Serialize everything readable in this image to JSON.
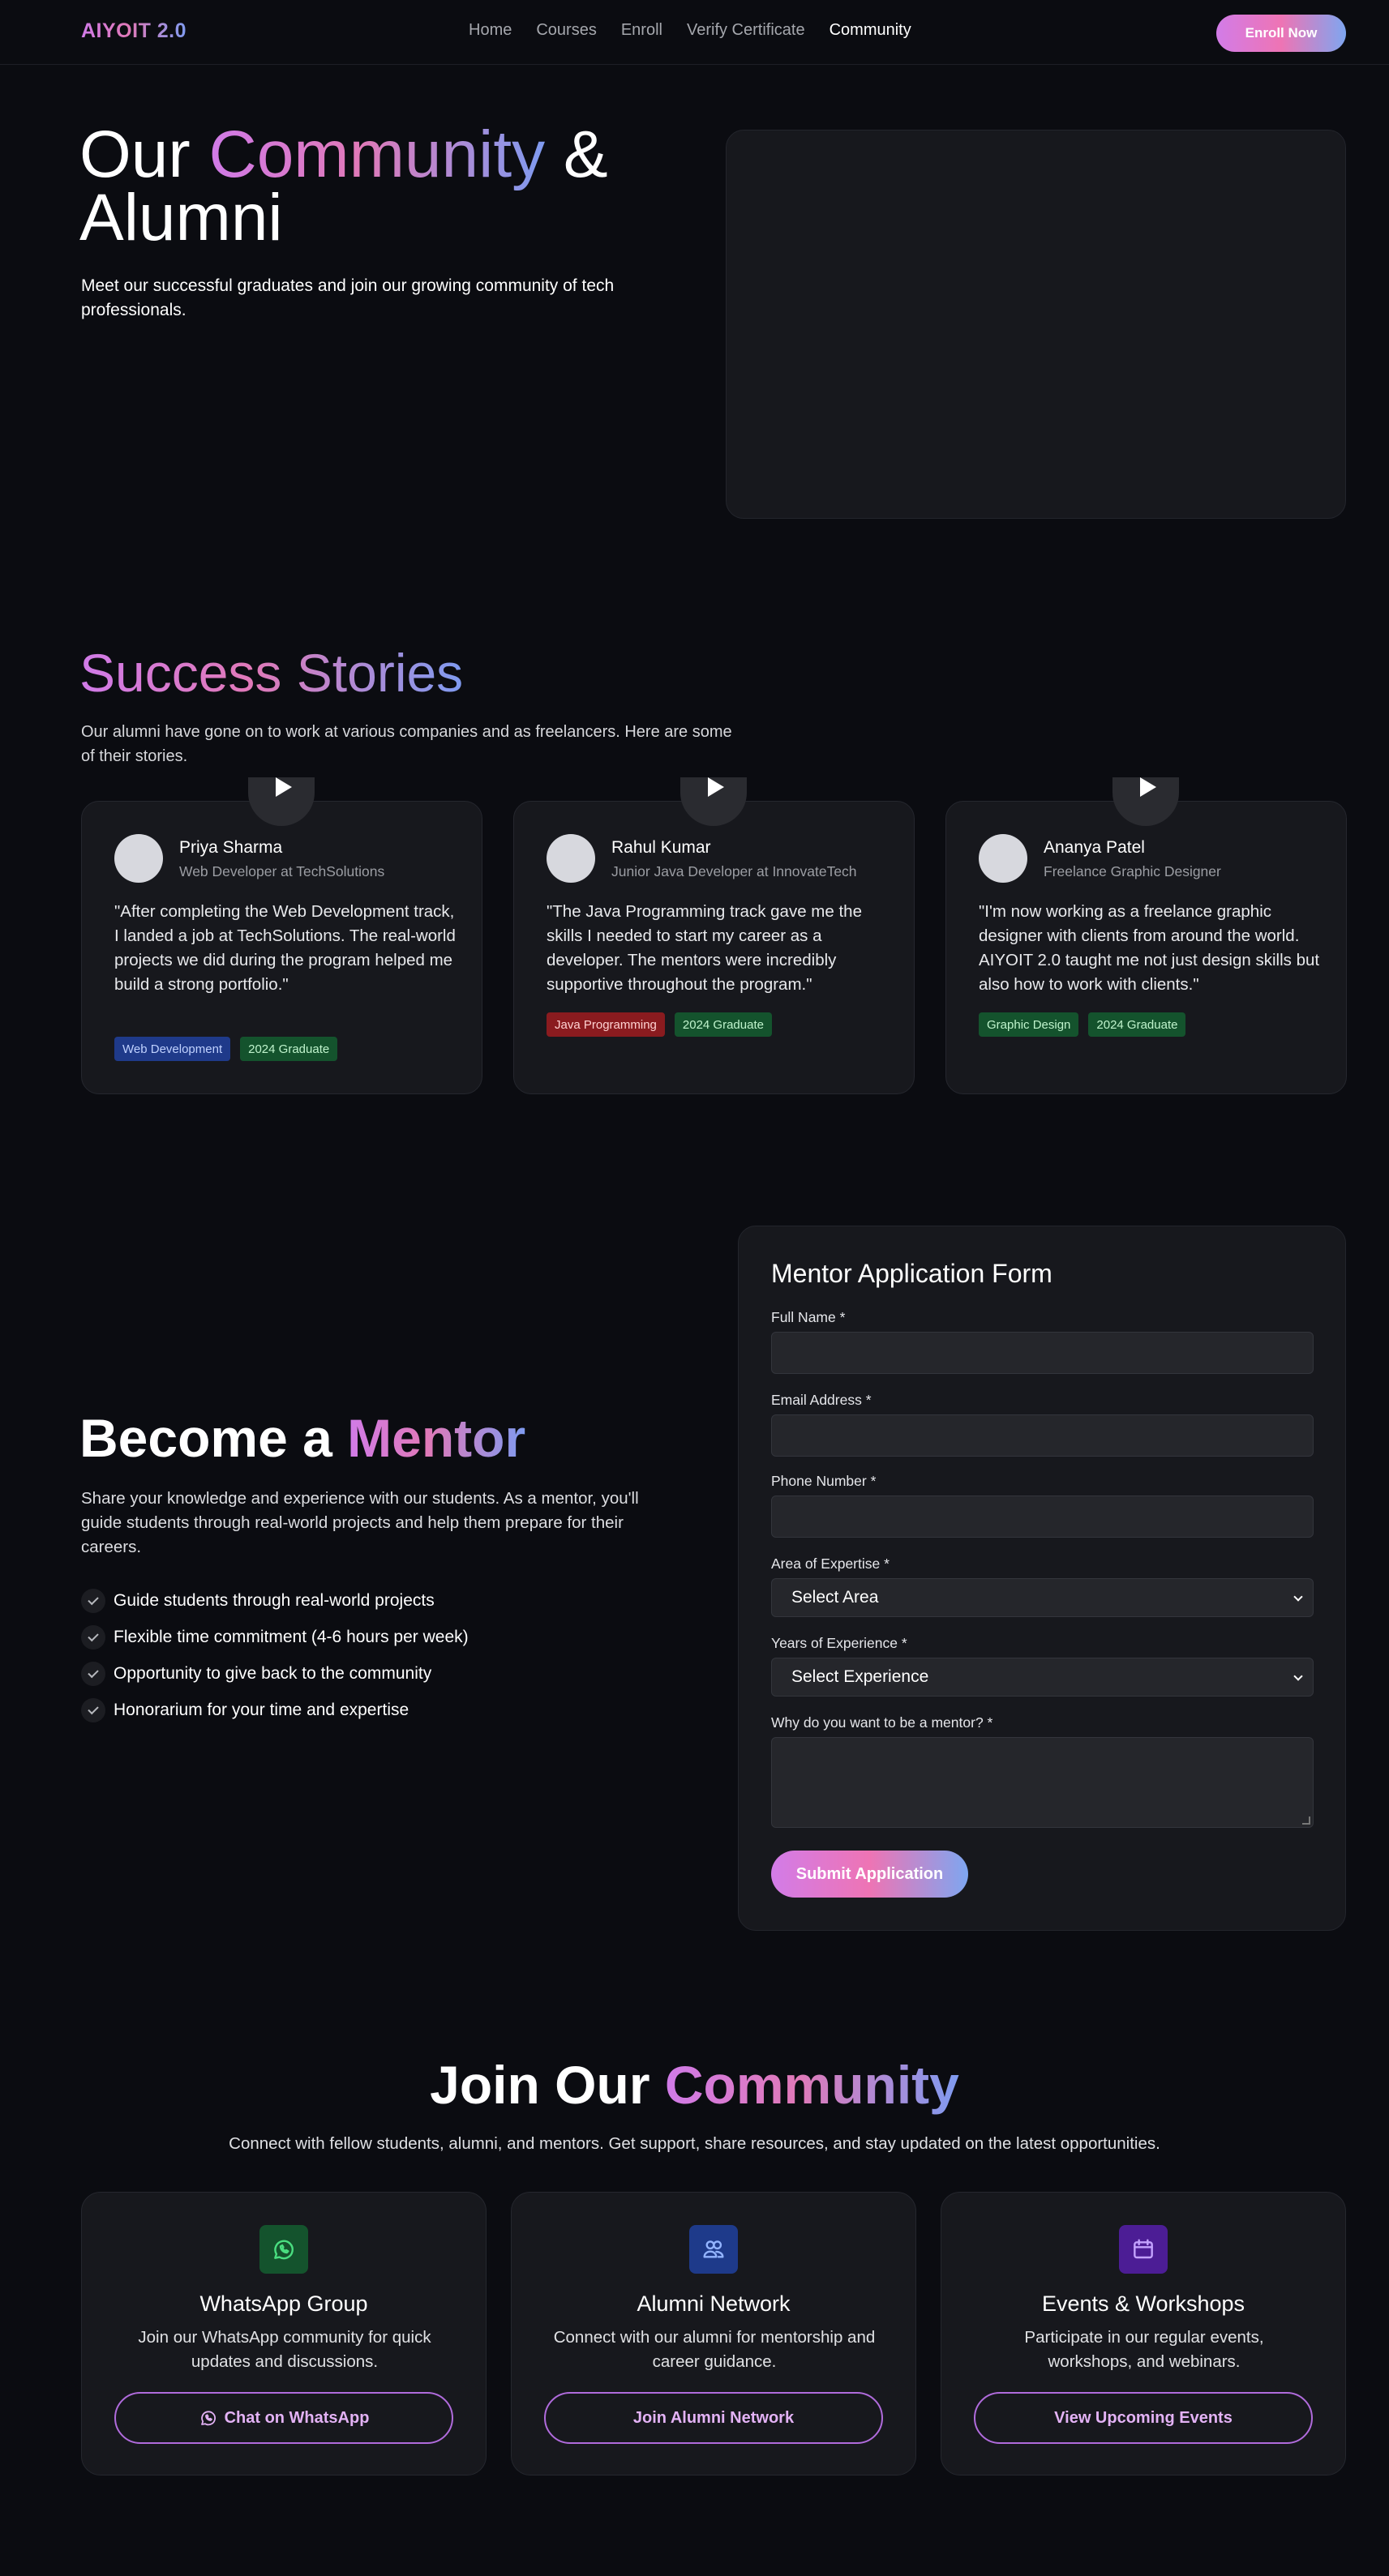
{
  "nav": {
    "logo": "AIYOIT 2.0",
    "links": [
      "Home",
      "Courses",
      "Enroll",
      "Verify Certificate",
      "Community"
    ],
    "active": "Community",
    "cta": "Enroll Now"
  },
  "hero": {
    "title_pre": "Our ",
    "title_accent": "Community",
    "title_post": " & Alumni",
    "subtitle": "Meet our successful graduates and join our growing community of tech professionals."
  },
  "stories": {
    "title": "Success Stories",
    "subtitle": "Our alumni have gone on to work at various companies and as freelancers. Here are some of their stories.",
    "items": [
      {
        "name": "Priya Sharma",
        "role": "Web Developer at TechSolutions",
        "quote": "\"After completing the Web Development track, I landed a job at TechSolutions. The real-world projects we did during the program helped me build a strong portfolio.\"",
        "tags": [
          {
            "label": "Web Development",
            "color": "blue"
          },
          {
            "label": "2024 Graduate",
            "color": "green"
          }
        ]
      },
      {
        "name": "Rahul Kumar",
        "role": "Junior Java Developer at InnovateTech",
        "quote": "\"The Java Programming track gave me the skills I needed to start my career as a developer. The mentors were incredibly supportive throughout the program.\"",
        "tags": [
          {
            "label": "Java Programming",
            "color": "red"
          },
          {
            "label": "2024 Graduate",
            "color": "green"
          }
        ]
      },
      {
        "name": "Ananya Patel",
        "role": "Freelance Graphic Designer",
        "quote": "\"I'm now working as a freelance graphic designer with clients from around the world. AIYOIT 2.0 taught me not just design skills but also how to work with clients.\"",
        "tags": [
          {
            "label": "Graphic Design",
            "color": "green"
          },
          {
            "label": "2024 Graduate",
            "color": "green"
          }
        ]
      }
    ]
  },
  "mentor": {
    "title_pre": "Become a ",
    "title_accent": "Mentor",
    "subtitle": "Share your knowledge and experience with our students. As a mentor, you'll guide students through real-world projects and help them prepare for their careers.",
    "benefits": [
      "Guide students through real-world projects",
      "Flexible time commitment (4-6 hours per week)",
      "Opportunity to give back to the community",
      "Honorarium for your time and expertise"
    ],
    "form": {
      "title": "Mentor Application Form",
      "full_name_label": "Full Name *",
      "email_label": "Email Address *",
      "phone_label": "Phone Number *",
      "area_label": "Area of Expertise *",
      "area_value": "Select Area",
      "years_label": "Years of Experience *",
      "years_value": "Select Experience",
      "why_label": "Why do you want to be a mentor? *",
      "submit": "Submit Application"
    }
  },
  "join": {
    "title_pre": "Join Our ",
    "title_accent": "Community",
    "subtitle": "Connect with fellow students, alumni, and mentors. Get support, share resources, and stay updated on the latest opportunities.",
    "cards": [
      {
        "icon": "whatsapp-icon",
        "title": "WhatsApp Group",
        "desc": "Join our WhatsApp community for quick updates and discussions.",
        "button": "Chat on WhatsApp"
      },
      {
        "icon": "users-icon",
        "title": "Alumni Network",
        "desc": "Connect with our alumni for mentorship and career guidance.",
        "button": "Join Alumni Network"
      },
      {
        "icon": "calendar-icon",
        "title": "Events & Workshops",
        "desc": "Participate in our regular events, workshops, and webinars.",
        "button": "View Upcoming Events"
      }
    ]
  },
  "colors": {
    "background": "#0b0c11",
    "card": "#17181d",
    "gradient_start": "#d27ce8",
    "gradient_mid": "#ee74b4",
    "gradient_end": "#7ea6f0"
  }
}
